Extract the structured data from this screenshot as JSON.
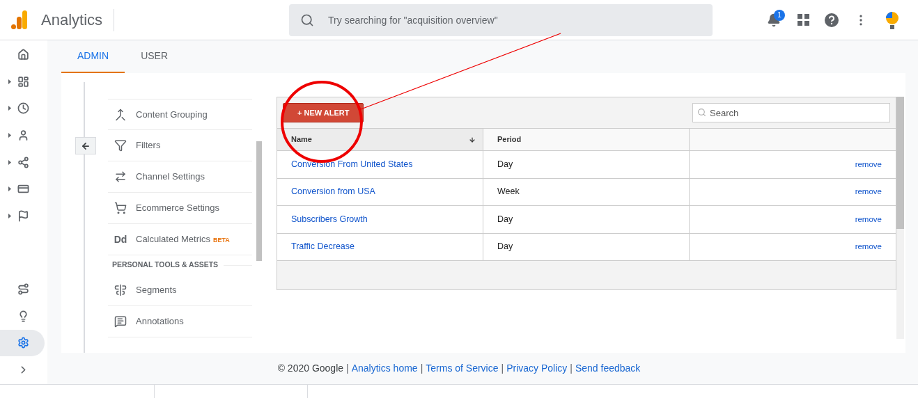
{
  "header": {
    "app_name": "Analytics",
    "search": {
      "placeholder": "Try searching for \"acquisition overview\""
    },
    "notification_count": "1"
  },
  "rail": {
    "items": [
      {
        "kind": "home",
        "expandable": false,
        "selected": false
      },
      {
        "kind": "dashboard",
        "expandable": true,
        "selected": false
      },
      {
        "kind": "clock",
        "expandable": true,
        "selected": false
      },
      {
        "kind": "person",
        "expandable": true,
        "selected": false
      },
      {
        "kind": "branches",
        "expandable": true,
        "selected": false
      },
      {
        "kind": "card",
        "expandable": true,
        "selected": false
      },
      {
        "kind": "flag",
        "expandable": true,
        "selected": false
      }
    ],
    "bottom_items": [
      {
        "kind": "route",
        "selected": false
      },
      {
        "kind": "bulb",
        "selected": false
      },
      {
        "kind": "gear",
        "selected": true
      },
      {
        "kind": "chevron",
        "selected": false
      }
    ]
  },
  "tabs": [
    {
      "label": "ADMIN",
      "selected": true
    },
    {
      "label": "USER",
      "selected": false
    }
  ],
  "nav": [
    {
      "kind": "item",
      "label": "Content Grouping"
    },
    {
      "kind": "item",
      "label": "Filters"
    },
    {
      "kind": "item",
      "label": "Channel Settings"
    },
    {
      "kind": "item",
      "label": "Ecommerce Settings"
    },
    {
      "kind": "item",
      "icon_text": "Dd",
      "label": "Calculated Metrics",
      "badge": "BETA"
    },
    {
      "kind": "heading",
      "label": "PERSONAL TOOLS & ASSETS"
    },
    {
      "kind": "item",
      "label": "Segments"
    },
    {
      "kind": "item",
      "label": "Annotations"
    }
  ],
  "alerts": {
    "new_button": "+ NEW ALERT",
    "search": {
      "placeholder": "Search"
    },
    "columns": [
      {
        "label": "Name",
        "sorted": true
      },
      {
        "label": "Period",
        "sorted": false
      }
    ],
    "rows": [
      {
        "name": "Conversion From United States",
        "period": "Day",
        "action": "remove"
      },
      {
        "name": "Conversion from USA",
        "period": "Week",
        "action": "remove"
      },
      {
        "name": "Subscribers Growth",
        "period": "Day",
        "action": "remove"
      },
      {
        "name": "Traffic Decrease",
        "period": "Day",
        "action": "remove"
      }
    ]
  },
  "footer": {
    "items": [
      {
        "kind": "text",
        "text": "© 2020 Google"
      },
      {
        "kind": "separator",
        "text": "|"
      },
      {
        "kind": "link",
        "text": "Analytics home"
      },
      {
        "kind": "separator",
        "text": "|"
      },
      {
        "kind": "link",
        "text": "Terms of Service"
      },
      {
        "kind": "separator",
        "text": "|"
      },
      {
        "kind": "link",
        "text": "Privacy Policy"
      },
      {
        "kind": "separator",
        "text": "|"
      },
      {
        "kind": "link",
        "text": "Send feedback"
      }
    ]
  }
}
